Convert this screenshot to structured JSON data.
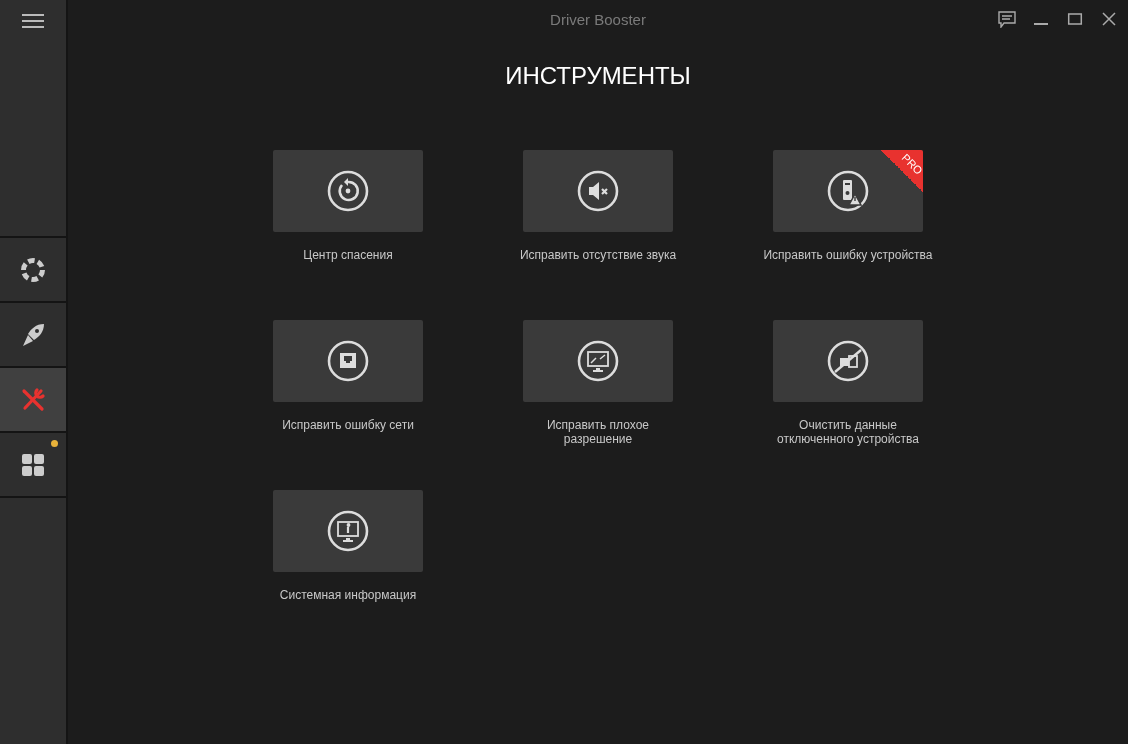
{
  "window": {
    "title": "Driver Booster"
  },
  "sidebar": {
    "items": [
      {
        "kind": "rescue",
        "selected": false,
        "notification": false
      },
      {
        "kind": "boost",
        "selected": false,
        "notification": false
      },
      {
        "kind": "tools",
        "selected": true,
        "notification": false
      },
      {
        "kind": "apps",
        "selected": false,
        "notification": true
      }
    ]
  },
  "heading": "ИНСТРУМЕНТЫ",
  "tools": [
    {
      "kind": "rescue",
      "label": "Центр спасения"
    },
    {
      "kind": "sound",
      "label": "Исправить отсутствие звука"
    },
    {
      "kind": "device",
      "label": "Исправить ошибку устройства",
      "badge": "PRO"
    },
    {
      "kind": "network",
      "label": "Исправить ошибку сети"
    },
    {
      "kind": "resolution",
      "label": "Исправить плохое разрешение"
    },
    {
      "kind": "unplugged",
      "label": "Очистить данные отключенного устройства"
    },
    {
      "kind": "sysinfo",
      "label": "Системная информация"
    }
  ]
}
